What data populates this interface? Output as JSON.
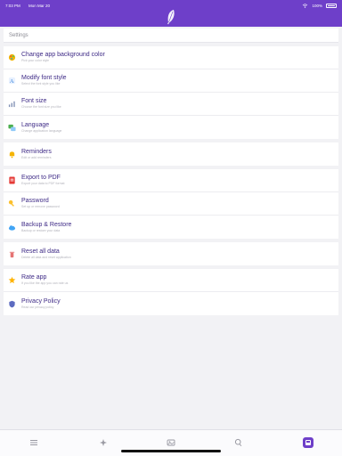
{
  "status_bar": {
    "time": "7:03 PM",
    "date": "Mon Mar 20",
    "battery_text": "100%"
  },
  "settings": {
    "header_title": "Settings",
    "sections": [
      {
        "items": [
          {
            "title": "Change app background color",
            "subtitle": "Pick your color style"
          },
          {
            "title": "Modify font style",
            "subtitle": "Select the font style you like"
          },
          {
            "title": "Font size",
            "subtitle": "Choose the font size you like"
          },
          {
            "title": "Language",
            "subtitle": "Change application language"
          }
        ]
      },
      {
        "items": [
          {
            "title": "Reminders",
            "subtitle": "Edit or add reminders"
          }
        ]
      },
      {
        "items": [
          {
            "title": "Export to PDF",
            "subtitle": "Export your data to PDF format"
          },
          {
            "title": "Password",
            "subtitle": "Set up or remove password"
          },
          {
            "title": "Backup & Restore",
            "subtitle": "Backup or restore your data"
          }
        ]
      },
      {
        "items": [
          {
            "title": "Reset all data",
            "subtitle": "Delete all data and reset application"
          }
        ]
      },
      {
        "items": [
          {
            "title": "Rate app",
            "subtitle": "If you like the app you can rate us"
          },
          {
            "title": "Privacy Policy",
            "subtitle": "Read our privacy policy"
          }
        ]
      }
    ]
  },
  "icons": {
    "feather": "feather-logo",
    "tabs": [
      "list-icon",
      "sparkle-icon",
      "gallery-icon",
      "search-icon",
      "settings-icon"
    ]
  },
  "colors": {
    "primary": "#6e3fc9",
    "text_title": "#3e2a86",
    "text_subtitle": "#b3b3bb"
  }
}
